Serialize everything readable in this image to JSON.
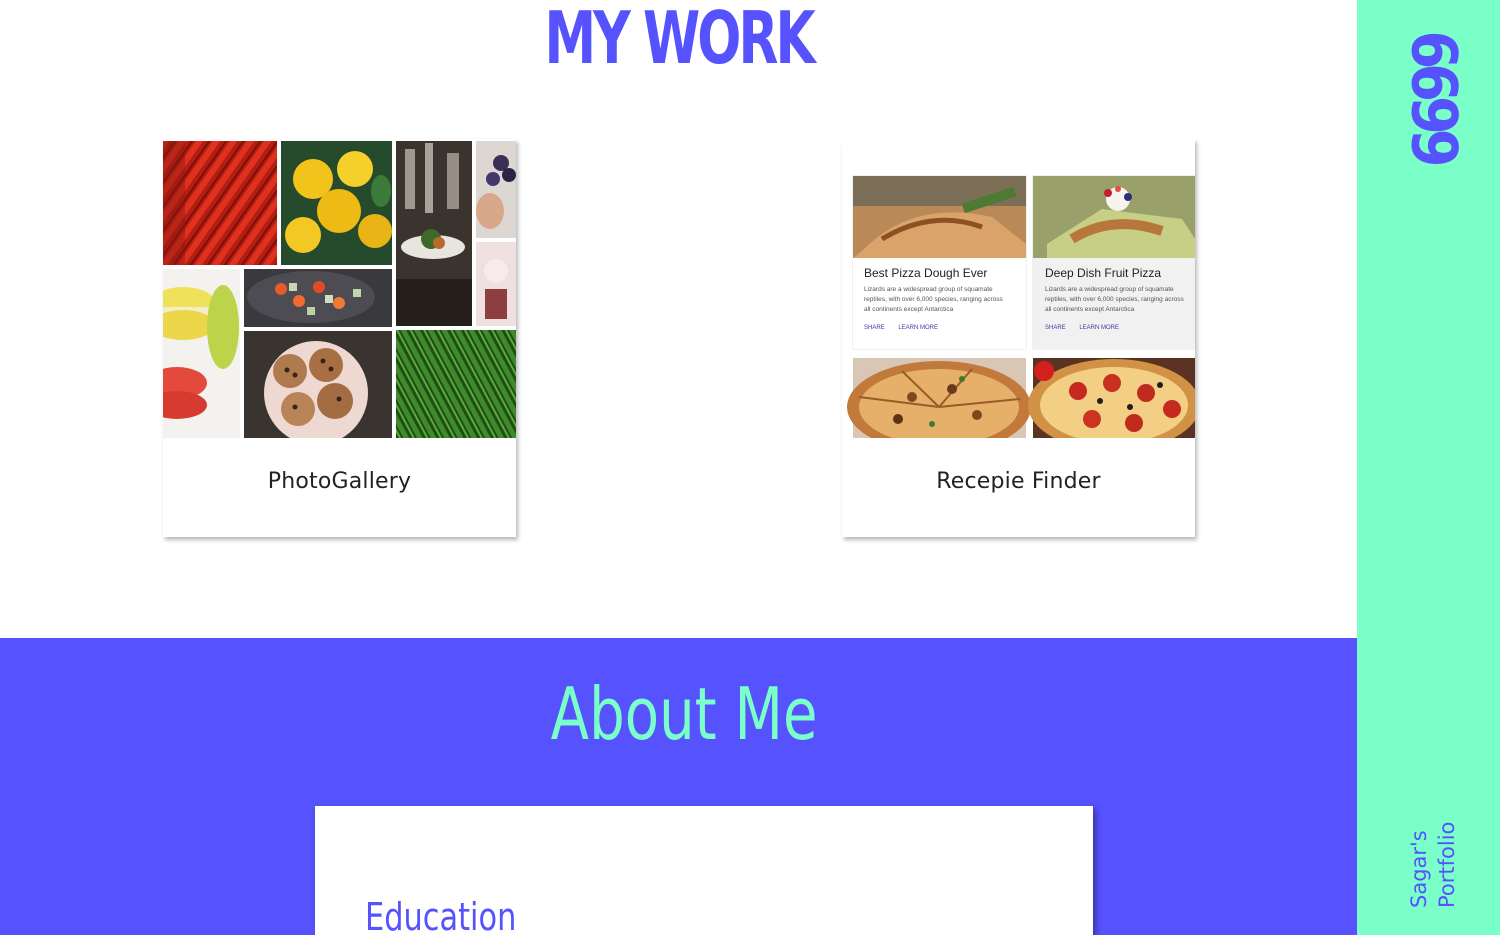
{
  "sidebar": {
    "logo_text": "6699",
    "title_line1": "Sagar's",
    "title_line2": "Portfolio",
    "bg_color": "#7affc8",
    "accent_color": "#5652fd"
  },
  "work": {
    "title": "MY WORK",
    "projects": [
      {
        "label": "PhotoGallery",
        "thumbnail": "food-photo-collage"
      },
      {
        "label": "Recepie Finder",
        "thumbnail": "recipe-cards-screenshot",
        "preview_cards": [
          {
            "title": "Best Pizza Dough Ever",
            "text_line1": "Lizards are a widespread group of squamate",
            "text_line2": "reptiles, with over 6,000 species, ranging across",
            "text_line3": "all continents except Antarctica",
            "share": "SHARE",
            "learn_more": "LEARN MORE"
          },
          {
            "title": "Deep Dish Fruit Pizza",
            "text_line1": "Lizards are a widespread group of squamate",
            "text_line2": "reptiles, with over 6,000 species, ranging across",
            "text_line3": "all continents except Antarctica",
            "share": "SHARE",
            "learn_more": "LEARN MORE"
          }
        ]
      }
    ]
  },
  "about": {
    "title": "About Me",
    "education_heading": "Education",
    "bg_color": "#5652fd",
    "title_color": "#7affc8"
  }
}
